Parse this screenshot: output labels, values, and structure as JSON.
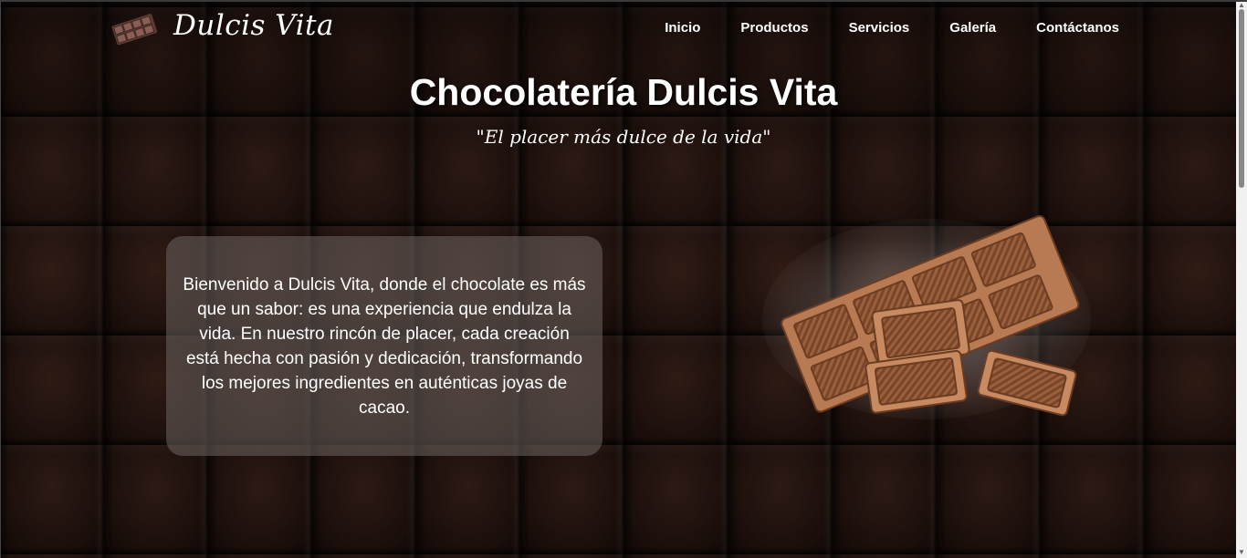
{
  "nav": {
    "brand": "Dulcis Vita",
    "logo_icon": "chocolate-bar-icon",
    "links": [
      "Inicio",
      "Productos",
      "Servicios",
      "Galería",
      "Contáctanos"
    ]
  },
  "hero": {
    "title": "Chocolatería Dulcis Vita",
    "tagline": "\"El placer más dulce de la vida\"",
    "welcome": "Bienvenido a Dulcis Vita, donde el chocolate es más que un sabor: es una experiencia que endulza la vida. En nuestro rincón de placer, cada creación está hecha con pasión y dedicación, transformando los mejores ingredientes en auténticas joyas de cacao.",
    "image_icon": "milk-chocolate-bar-image"
  },
  "colors": {
    "background": "#1c100c",
    "chocolate": "#a56a45",
    "text": "#ffffff",
    "card": "rgba(110,100,96,0.55)"
  }
}
